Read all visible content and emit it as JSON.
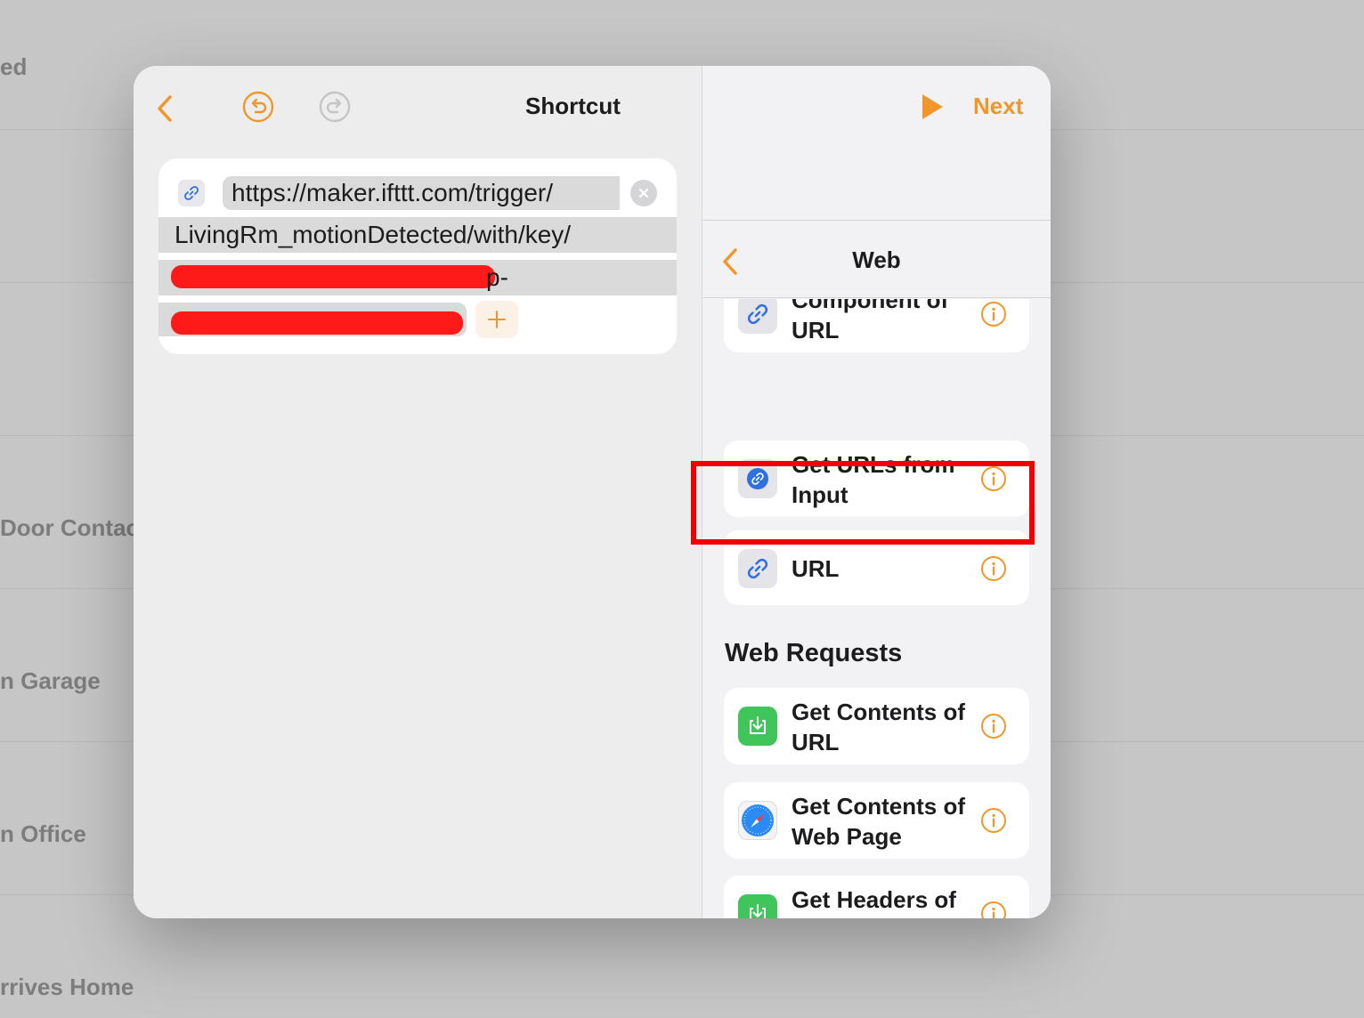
{
  "background": {
    "rows": [
      {
        "label": "ed"
      },
      {
        "label": "Door Contac"
      },
      {
        "label": "n Garage"
      },
      {
        "label": "n Office"
      },
      {
        "label": "rrives Home"
      }
    ]
  },
  "editor": {
    "title": "Shortcut",
    "url_action": {
      "line1": "https://maker.ifttt.com/trigger/",
      "line2": "LivingRm_motionDetected/with/key/",
      "line3_tail": "p-"
    }
  },
  "sidebar": {
    "next_label": "Next",
    "category_title": "Web",
    "items": [
      {
        "label": "Component of URL",
        "icon": "link-icon"
      },
      {
        "label": "Get URLs from Input",
        "icon": "link-icon"
      },
      {
        "label": "URL",
        "icon": "link-icon"
      }
    ],
    "section_title": "Web Requests",
    "request_items": [
      {
        "label": "Get Contents of URL",
        "icon": "download-icon"
      },
      {
        "label": "Get Contents of Web Page",
        "icon": "safari-icon"
      },
      {
        "label": "Get Headers of URL",
        "icon": "download-icon"
      }
    ]
  },
  "colors": {
    "accent": "#f0962a",
    "highlight": "#ef0000",
    "link_blue": "#2f6fe0",
    "green": "#3fc55a"
  }
}
